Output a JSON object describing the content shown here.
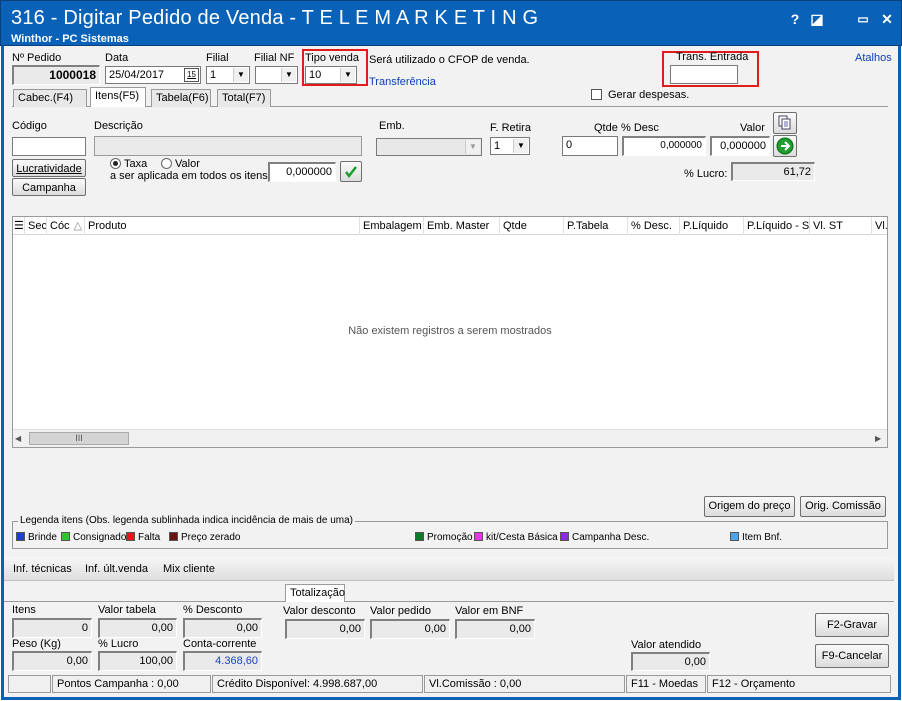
{
  "window": {
    "title": "316 - Digitar Pedido de Venda - T E L E M A R K E T I N G",
    "subtitle": "Winthor - PC Sistemas",
    "help_label": "?",
    "restore_glyph": "◪",
    "minimize_glyph": "▭",
    "close_glyph": "✕"
  },
  "header": {
    "pedido_label": "Nº Pedido",
    "pedido_value": "1000018",
    "data_label": "Data",
    "data_value": "25/04/2017",
    "calendar_glyph": "15",
    "filial_label": "Filial",
    "filial_value": "1",
    "filial_nf_label": "Filial NF",
    "filial_nf_value": "",
    "tipo_venda_label": "Tipo venda",
    "tipo_venda_value": "10",
    "cfop_text": "Será utilizado o CFOP de venda.",
    "transferencia_link": "Transferência",
    "trans_entrada_label": "Trans. Entrada",
    "trans_entrada_value": "",
    "atalhos_link": "Atalhos",
    "gerar_despesas_label": "Gerar despesas."
  },
  "tabs": [
    "Cabec.(F4)",
    "Itens(F5)",
    "Tabela(F6)",
    "Total(F7)"
  ],
  "item_entry": {
    "codigo_label": "Código",
    "descricao_label": "Descrição",
    "emb_label": "Emb.",
    "fretira_label": "F. Retira",
    "fretira_value": "1",
    "qtde_label": "Qtde",
    "desc_label": "% Desc",
    "valor_label": "Valor",
    "qtde_value": "0",
    "desc_value": "0,000000",
    "valor_value": "0,000000",
    "lucratividade_button": "Lucratividade",
    "campanha_button": "Campanha",
    "taxa_label": "Taxa",
    "valor_radio_label": "Valor",
    "aplicada_label": "a ser aplicada em todos os itens:",
    "aplicada_value": "0,000000",
    "lucro_label": "% Lucro:",
    "lucro_value": "61,72"
  },
  "grid": {
    "columns": [
      "Sec",
      "Cóc",
      "Produto",
      "Embalagem",
      "Emb. Master",
      "Qtde",
      "P.Tabela",
      "% Desc.",
      "P.Líquido",
      "P.Líquido - S",
      "Vl. ST",
      "Vl."
    ],
    "empty_message": "Não existem registros a serem mostrados",
    "scroll_grip": "III"
  },
  "buttons": {
    "origem_preco": "Origem do preço",
    "orig_comissao": "Orig. Comissão",
    "gravar": "F2-Gravar",
    "cancelar": "F9-Cancelar"
  },
  "legend": {
    "title": "Legenda itens (Obs. legenda sublinhada indica incidência de mais de uma)",
    "items": [
      {
        "label": "Brinde",
        "color": "#1f3fd0"
      },
      {
        "label": "Consignado",
        "color": "#2ec82e"
      },
      {
        "label": "Falta",
        "color": "#e01a1a"
      },
      {
        "label": "Preço zerado",
        "color": "#6b1212"
      },
      {
        "label": "Promoção",
        "color": "#0d7a2a"
      },
      {
        "label": "kit/Cesta Básica",
        "color": "#e03ae0"
      },
      {
        "label": "Campanha Desc.",
        "color": "#8a2be2"
      },
      {
        "label": "Item Bnf.",
        "color": "#4ea3e8"
      }
    ]
  },
  "info_links": [
    "Inf. técnicas",
    "Inf. últ.venda",
    "Mix cliente"
  ],
  "totals": {
    "tab_label": "Totalização",
    "itens_label": "Itens",
    "itens_value": "0",
    "valor_tabela_label": "Valor tabela",
    "valor_tabela_value": "0,00",
    "desconto_label": "% Desconto",
    "desconto_value": "0,00",
    "valor_desconto_label": "Valor desconto",
    "valor_desconto_value": "0,00",
    "valor_pedido_label": "Valor pedido",
    "valor_pedido_value": "0,00",
    "valor_bnf_label": "Valor em BNF",
    "valor_bnf_value": "0,00",
    "peso_label": "Peso (Kg)",
    "peso_value": "0,00",
    "lucro_label": "% Lucro",
    "lucro_value": "100,00",
    "conta_label": "Conta-corrente",
    "conta_value": "4.368,60",
    "valor_atendido_label": "Valor atendido",
    "valor_atendido_value": "0,00"
  },
  "statusbar": {
    "pontos": "Pontos Campanha : 0,00",
    "credito": "Crédito Disponível: 4.998.687,00",
    "comissao": "Vl.Comissão : 0,00",
    "moedas": "F11 - Moedas",
    "orcamento": "F12 - Orçamento"
  },
  "colors": {
    "title_bar": "#0a62b8",
    "highlight_box": "#e21b1b",
    "link": "#0a3fb8"
  }
}
